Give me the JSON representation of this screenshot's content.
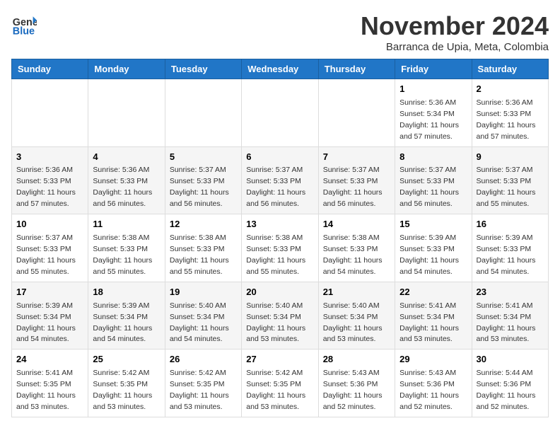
{
  "logo": {
    "general": "General",
    "blue": "Blue"
  },
  "title": "November 2024",
  "location": "Barranca de Upia, Meta, Colombia",
  "weekdays": [
    "Sunday",
    "Monday",
    "Tuesday",
    "Wednesday",
    "Thursday",
    "Friday",
    "Saturday"
  ],
  "weeks": [
    [
      {
        "day": "",
        "info": ""
      },
      {
        "day": "",
        "info": ""
      },
      {
        "day": "",
        "info": ""
      },
      {
        "day": "",
        "info": ""
      },
      {
        "day": "",
        "info": ""
      },
      {
        "day": "1",
        "info": "Sunrise: 5:36 AM\nSunset: 5:34 PM\nDaylight: 11 hours and 57 minutes."
      },
      {
        "day": "2",
        "info": "Sunrise: 5:36 AM\nSunset: 5:33 PM\nDaylight: 11 hours and 57 minutes."
      }
    ],
    [
      {
        "day": "3",
        "info": "Sunrise: 5:36 AM\nSunset: 5:33 PM\nDaylight: 11 hours and 57 minutes."
      },
      {
        "day": "4",
        "info": "Sunrise: 5:36 AM\nSunset: 5:33 PM\nDaylight: 11 hours and 56 minutes."
      },
      {
        "day": "5",
        "info": "Sunrise: 5:37 AM\nSunset: 5:33 PM\nDaylight: 11 hours and 56 minutes."
      },
      {
        "day": "6",
        "info": "Sunrise: 5:37 AM\nSunset: 5:33 PM\nDaylight: 11 hours and 56 minutes."
      },
      {
        "day": "7",
        "info": "Sunrise: 5:37 AM\nSunset: 5:33 PM\nDaylight: 11 hours and 56 minutes."
      },
      {
        "day": "8",
        "info": "Sunrise: 5:37 AM\nSunset: 5:33 PM\nDaylight: 11 hours and 56 minutes."
      },
      {
        "day": "9",
        "info": "Sunrise: 5:37 AM\nSunset: 5:33 PM\nDaylight: 11 hours and 55 minutes."
      }
    ],
    [
      {
        "day": "10",
        "info": "Sunrise: 5:37 AM\nSunset: 5:33 PM\nDaylight: 11 hours and 55 minutes."
      },
      {
        "day": "11",
        "info": "Sunrise: 5:38 AM\nSunset: 5:33 PM\nDaylight: 11 hours and 55 minutes."
      },
      {
        "day": "12",
        "info": "Sunrise: 5:38 AM\nSunset: 5:33 PM\nDaylight: 11 hours and 55 minutes."
      },
      {
        "day": "13",
        "info": "Sunrise: 5:38 AM\nSunset: 5:33 PM\nDaylight: 11 hours and 55 minutes."
      },
      {
        "day": "14",
        "info": "Sunrise: 5:38 AM\nSunset: 5:33 PM\nDaylight: 11 hours and 54 minutes."
      },
      {
        "day": "15",
        "info": "Sunrise: 5:39 AM\nSunset: 5:33 PM\nDaylight: 11 hours and 54 minutes."
      },
      {
        "day": "16",
        "info": "Sunrise: 5:39 AM\nSunset: 5:33 PM\nDaylight: 11 hours and 54 minutes."
      }
    ],
    [
      {
        "day": "17",
        "info": "Sunrise: 5:39 AM\nSunset: 5:34 PM\nDaylight: 11 hours and 54 minutes."
      },
      {
        "day": "18",
        "info": "Sunrise: 5:39 AM\nSunset: 5:34 PM\nDaylight: 11 hours and 54 minutes."
      },
      {
        "day": "19",
        "info": "Sunrise: 5:40 AM\nSunset: 5:34 PM\nDaylight: 11 hours and 54 minutes."
      },
      {
        "day": "20",
        "info": "Sunrise: 5:40 AM\nSunset: 5:34 PM\nDaylight: 11 hours and 53 minutes."
      },
      {
        "day": "21",
        "info": "Sunrise: 5:40 AM\nSunset: 5:34 PM\nDaylight: 11 hours and 53 minutes."
      },
      {
        "day": "22",
        "info": "Sunrise: 5:41 AM\nSunset: 5:34 PM\nDaylight: 11 hours and 53 minutes."
      },
      {
        "day": "23",
        "info": "Sunrise: 5:41 AM\nSunset: 5:34 PM\nDaylight: 11 hours and 53 minutes."
      }
    ],
    [
      {
        "day": "24",
        "info": "Sunrise: 5:41 AM\nSunset: 5:35 PM\nDaylight: 11 hours and 53 minutes."
      },
      {
        "day": "25",
        "info": "Sunrise: 5:42 AM\nSunset: 5:35 PM\nDaylight: 11 hours and 53 minutes."
      },
      {
        "day": "26",
        "info": "Sunrise: 5:42 AM\nSunset: 5:35 PM\nDaylight: 11 hours and 53 minutes."
      },
      {
        "day": "27",
        "info": "Sunrise: 5:42 AM\nSunset: 5:35 PM\nDaylight: 11 hours and 53 minutes."
      },
      {
        "day": "28",
        "info": "Sunrise: 5:43 AM\nSunset: 5:36 PM\nDaylight: 11 hours and 52 minutes."
      },
      {
        "day": "29",
        "info": "Sunrise: 5:43 AM\nSunset: 5:36 PM\nDaylight: 11 hours and 52 minutes."
      },
      {
        "day": "30",
        "info": "Sunrise: 5:44 AM\nSunset: 5:36 PM\nDaylight: 11 hours and 52 minutes."
      }
    ]
  ]
}
